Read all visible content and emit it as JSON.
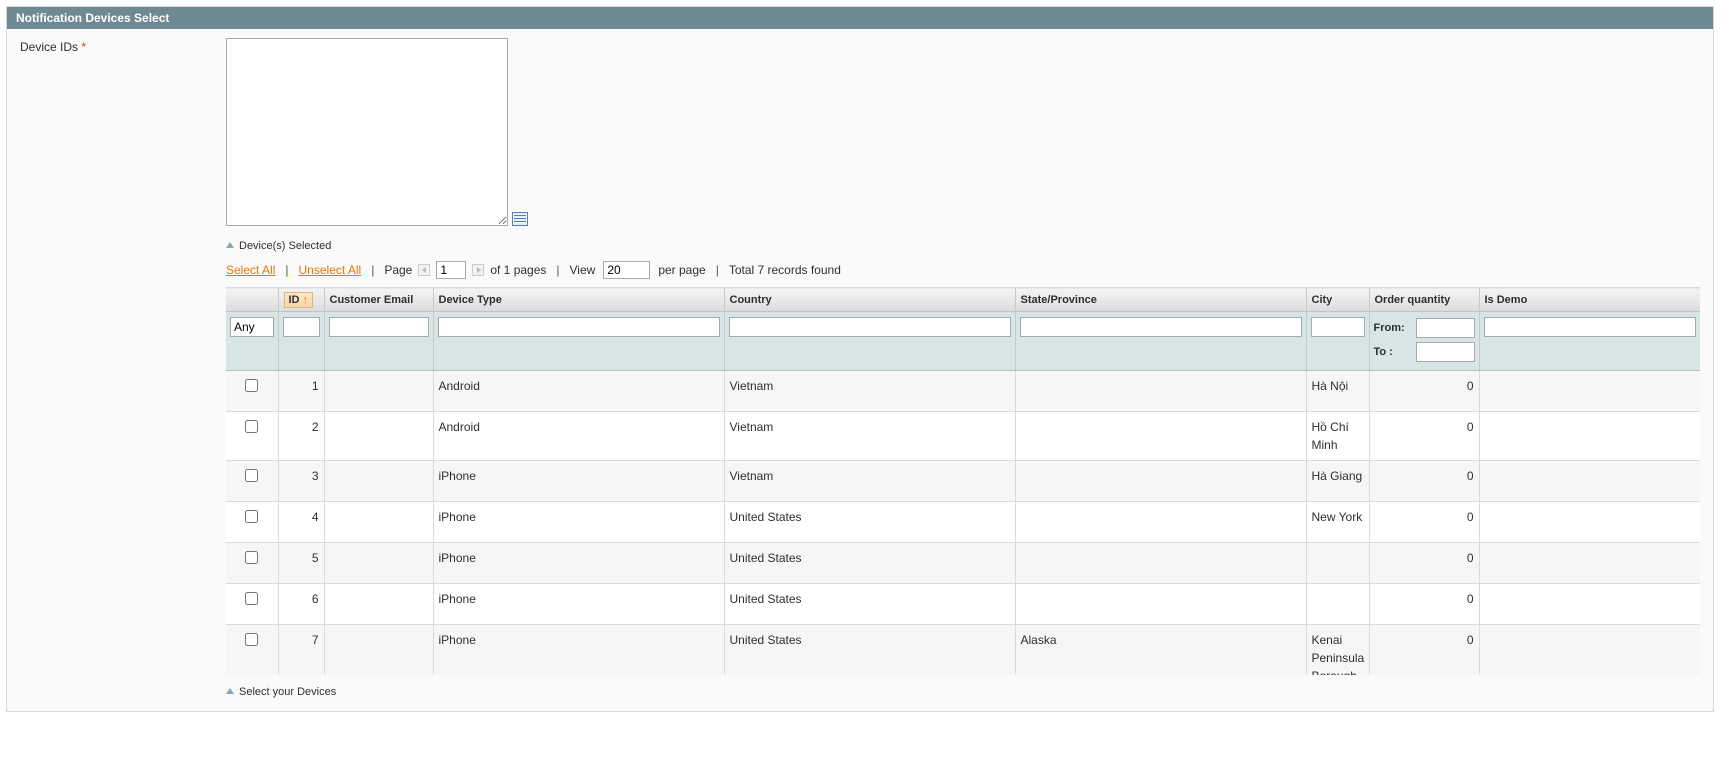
{
  "section": {
    "title": "Notification Devices Select"
  },
  "form": {
    "device_ids_label": "Device IDs",
    "required_mark": "*",
    "device_ids_value": "",
    "devices_selected_note": "Device(s) Selected",
    "select_devices_note": "Select your Devices"
  },
  "pager": {
    "select_all": "Select All",
    "unselect_all": "Unselect All",
    "page_label": "Page",
    "page_value": "1",
    "of_pages": "of 1 pages",
    "view_label": "View",
    "view_value": "20",
    "per_page": "per page",
    "total": "Total 7 records found"
  },
  "grid": {
    "columns": [
      "",
      "ID",
      "Customer Email",
      "Device Type",
      "Country",
      "State/Province",
      "City",
      "Order quantity",
      "Is Demo"
    ],
    "sorted_column": "ID",
    "filter": {
      "select_value": "Any",
      "from_label": "From:",
      "to_label": "To :"
    },
    "rows": [
      {
        "id": "1",
        "email": "",
        "device_type": "Android",
        "country": "Vietnam",
        "state": "",
        "city": "Hà Nội",
        "order_qty": "0",
        "is_demo": ""
      },
      {
        "id": "2",
        "email": "",
        "device_type": "Android",
        "country": "Vietnam",
        "state": "",
        "city": "Hồ Chí Minh",
        "order_qty": "0",
        "is_demo": ""
      },
      {
        "id": "3",
        "email": "",
        "device_type": "iPhone",
        "country": "Vietnam",
        "state": "",
        "city": "Hà Giang",
        "order_qty": "0",
        "is_demo": ""
      },
      {
        "id": "4",
        "email": "",
        "device_type": "iPhone",
        "country": "United States",
        "state": "",
        "city": "New York",
        "order_qty": "0",
        "is_demo": ""
      },
      {
        "id": "5",
        "email": "",
        "device_type": "iPhone",
        "country": "United States",
        "state": "",
        "city": "",
        "order_qty": "0",
        "is_demo": ""
      },
      {
        "id": "6",
        "email": "",
        "device_type": "iPhone",
        "country": "United States",
        "state": "",
        "city": "",
        "order_qty": "0",
        "is_demo": ""
      },
      {
        "id": "7",
        "email": "",
        "device_type": "iPhone",
        "country": "United States",
        "state": "Alaska",
        "city": "Kenai Peninsula Borough",
        "order_qty": "0",
        "is_demo": ""
      }
    ]
  },
  "colors": {
    "header_bg": "#6f8992",
    "link": "#ea7601",
    "filter_bg": "#d7e5e7",
    "required": "#eb340a"
  },
  "icons": {
    "chooser": "grid-chooser-icon",
    "sort": "sort-ascending-icon",
    "note": "collapse-triangle-icon"
  }
}
